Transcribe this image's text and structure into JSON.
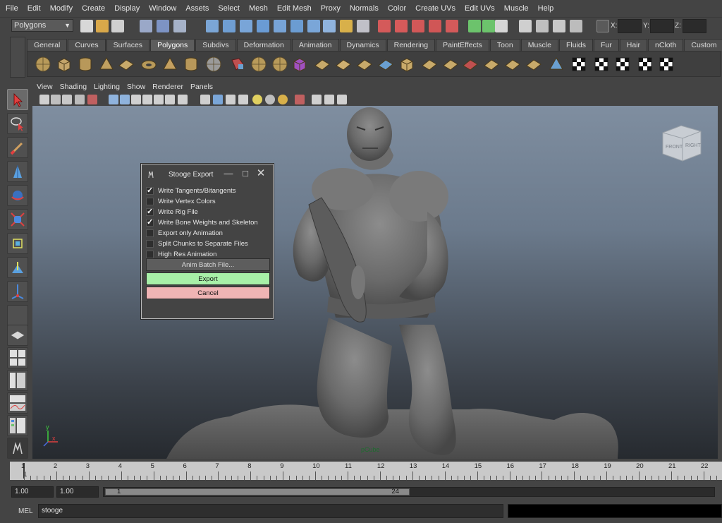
{
  "menubar": {
    "items": [
      "File",
      "Edit",
      "Modify",
      "Create",
      "Display",
      "Window",
      "Assets",
      "Select",
      "Mesh",
      "Edit Mesh",
      "Proxy",
      "Normals",
      "Color",
      "Create UVs",
      "Edit UVs",
      "Muscle",
      "Help"
    ]
  },
  "statusline": {
    "mode": "Polygons",
    "x_label": "X:",
    "y_label": "Y:",
    "z_label": "Z:"
  },
  "shelf": {
    "tabs": [
      "General",
      "Curves",
      "Surfaces",
      "Polygons",
      "Subdivs",
      "Deformation",
      "Animation",
      "Dynamics",
      "Rendering",
      "PaintEffects",
      "Toon",
      "Muscle",
      "Fluids",
      "Fur",
      "Hair",
      "nCloth",
      "Custom"
    ],
    "active_tab": "Polygons"
  },
  "panel": {
    "menu": [
      "View",
      "Shading",
      "Lighting",
      "Show",
      "Renderer",
      "Panels"
    ]
  },
  "viewcube": {
    "front": "FRONT",
    "right": "RIGHT"
  },
  "dialog": {
    "title": "Stooge Export",
    "options": [
      {
        "label": "Write Tangents/Bitangents",
        "checked": true
      },
      {
        "label": "Write Vertex Colors",
        "checked": false
      },
      {
        "label": "Write Rig File",
        "checked": true
      },
      {
        "label": "Write Bone Weights and Skeleton",
        "checked": true
      },
      {
        "label": "Export only Animation",
        "checked": false
      },
      {
        "label": "Split Chunks to Separate Files",
        "checked": false
      },
      {
        "label": "High Res Animation",
        "checked": false
      }
    ],
    "anim_batch_label": "Anim Batch File...",
    "export_label": "Export",
    "cancel_label": "Cancel",
    "colors": {
      "export_bg": "#a8f0a8",
      "cancel_bg": "#f0b4b4"
    }
  },
  "axis_indicator": {
    "y": "y",
    "x": "x"
  },
  "timeslider": {
    "numbers": [
      "1",
      "2",
      "3",
      "4",
      "5",
      "6",
      "7",
      "8",
      "9",
      "10",
      "11",
      "12",
      "13",
      "14",
      "15",
      "16",
      "17",
      "18",
      "19",
      "20",
      "21",
      "22"
    ],
    "current_frame": "1"
  },
  "rangebar": {
    "start_time": "1.00",
    "playback_start": "1.00",
    "range_start": "1",
    "range_end": "24"
  },
  "cmdline": {
    "label": "MEL",
    "value": "stooge"
  }
}
